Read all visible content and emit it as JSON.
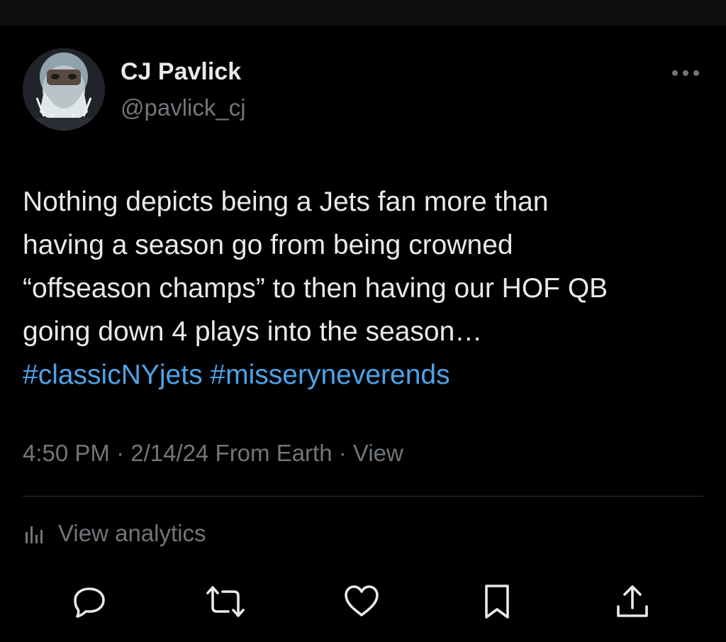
{
  "author": {
    "display_name": "CJ Pavlick",
    "handle": "@pavlick_cj"
  },
  "tweet": {
    "lines": [
      "Nothing depicts being a Jets fan more than",
      "having a season go from being crowned",
      "“offseason champs” to then having our HOF QB",
      "going down 4 plays into the season…"
    ],
    "hashtags": [
      "#classicNYjets",
      "#misseryneverends"
    ]
  },
  "meta": {
    "time": "4:50 PM",
    "date": "2/14/24",
    "location": "From Earth",
    "separator": "·",
    "view_label": "View"
  },
  "analytics": {
    "label": "View analytics"
  },
  "actions": [
    {
      "name": "reply",
      "icon": "reply-icon"
    },
    {
      "name": "repost",
      "icon": "repost-icon"
    },
    {
      "name": "like",
      "icon": "heart-icon"
    },
    {
      "name": "bookmark",
      "icon": "bookmark-icon"
    },
    {
      "name": "share",
      "icon": "share-icon"
    }
  ],
  "colors": {
    "background": "#000000",
    "text": "#e7e9ea",
    "secondary": "#71767b",
    "hashtag": "#4da3e8",
    "divider": "#2f3336"
  }
}
